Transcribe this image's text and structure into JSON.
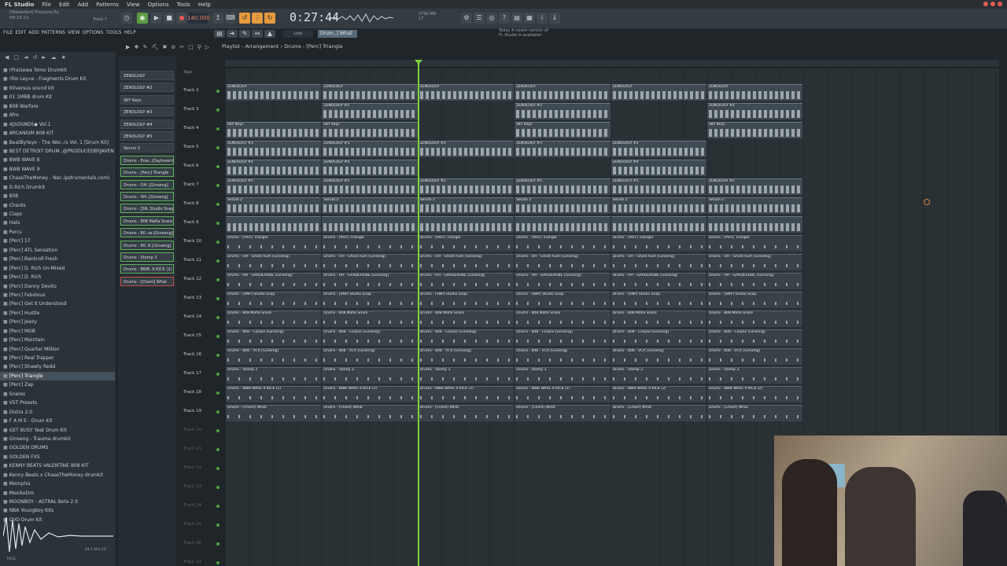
{
  "menubar": {
    "app": "FL Studio",
    "items": [
      "File",
      "Edit",
      "Add",
      "Patterns",
      "View",
      "Options",
      "Tools",
      "Help"
    ]
  },
  "toolbar": {
    "project_name": "[Waeerbot] Froyone.flp",
    "project_time": "58:15:21",
    "track_label": "Track 7",
    "tempo": "140.000",
    "time": "0:27:44",
    "cpu_line1": "5790 MB",
    "cpu_line2": "17",
    "hint_line1": "Today  A newer version of",
    "hint_line2": "FL Studio is available!",
    "snap": "Line",
    "pattern": "Drum..] What"
  },
  "menu_row2": [
    "FILE",
    "EDIT",
    "ADD",
    "PATTERNS",
    "VIEW",
    "OPTIONS",
    "TOOLS",
    "HELP"
  ],
  "playlist": {
    "breadcrumb": "Playlist - Arrangement › Drums - [Perc] Triangle",
    "tracks_label": "Tags"
  },
  "browser": {
    "items": [
      {
        "label": "!Praizewa Tomo Drumkit",
        "sel": false
      },
      {
        "label": "!Rio Leyva - Fragments Drum Kit",
        "sel": false
      },
      {
        "label": "00versus sound kit",
        "sel": false
      },
      {
        "label": "01 1MBB drum Kit",
        "sel": false
      },
      {
        "label": "808 Warfare",
        "sel": false
      },
      {
        "label": "Afro",
        "sel": false
      },
      {
        "label": "AJSOUNDS◆ Vol.1",
        "sel": false
      },
      {
        "label": "ARCANIUM 808 KIT",
        "sel": false
      },
      {
        "label": "BeatByYayo - The Wor..rs Vol. 1 [Drum Kit]",
        "sel": false
      },
      {
        "label": "BEST DETROIT DRUM..@PRODUCEDBYJAVEN",
        "sel": false
      },
      {
        "label": "BWB WAVE 8",
        "sel": false
      },
      {
        "label": "BWB WAVE 9",
        "sel": false
      },
      {
        "label": "ChaseTheMoney - Nar..ipstrumentals.com)",
        "sel": false
      },
      {
        "label": "D.Rich Drumkit",
        "sel": false
      },
      {
        "label": "808",
        "sel": false
      },
      {
        "label": "Chants",
        "sel": false
      },
      {
        "label": "Claps",
        "sel": false
      },
      {
        "label": "Hats",
        "sel": false
      },
      {
        "label": "Percs",
        "sel": false
      },
      {
        "label": "[Perc] 17",
        "sel": false
      },
      {
        "label": "[Perc] ATL Sensation",
        "sel": false
      },
      {
        "label": "[Perc] Bankroll Fresh",
        "sel": false
      },
      {
        "label": "[Perc] D. Rich Un-Mixed",
        "sel": false
      },
      {
        "label": "[Perc] D. Rich",
        "sel": false
      },
      {
        "label": "[Perc] Danny Devito",
        "sel": false
      },
      {
        "label": "[Perc] Fabolous",
        "sel": false
      },
      {
        "label": "[Perc] Get It Understood",
        "sel": false
      },
      {
        "label": "[Perc] Hustle",
        "sel": false
      },
      {
        "label": "[Perc] Jeezy",
        "sel": false
      },
      {
        "label": "[Perc] MOB",
        "sel": false
      },
      {
        "label": "[Perc] Maintain",
        "sel": false
      },
      {
        "label": "[Perc] Quarter Million",
        "sel": false
      },
      {
        "label": "[Perc] Real Trapper",
        "sel": false
      },
      {
        "label": "[Perc] Shawty Redd",
        "sel": false
      },
      {
        "label": "[Perc] Triangle",
        "sel": true
      },
      {
        "label": "[Perc] Zap",
        "sel": false
      },
      {
        "label": "Snares",
        "sel": false
      },
      {
        "label": "VST Presets",
        "sel": false
      },
      {
        "label": "Distra 2.0",
        "sel": false
      },
      {
        "label": "F A M E - Drum Kit",
        "sel": false
      },
      {
        "label": "GET BUSY Yeat Drum Kit",
        "sel": false
      },
      {
        "label": "Ginseng - Trauma drumkit",
        "sel": false
      },
      {
        "label": "GOLDEN DRUMS",
        "sel": false
      },
      {
        "label": "GOLDEN FXS",
        "sel": false
      },
      {
        "label": "KENNY BEATS VALENTINE 808 KIT",
        "sel": false
      },
      {
        "label": "Kenny Beats x ChaseTheMoney drumkit",
        "sel": false
      },
      {
        "label": "Memphis",
        "sel": false
      },
      {
        "label": "MexikoDro",
        "sel": false
      },
      {
        "label": "MOONBOY - ASTRAL Beta 2.0",
        "sel": false
      },
      {
        "label": "NBA Youngboy Kits",
        "sel": false
      },
      {
        "label": "OVO Drum Kit",
        "sel": false
      }
    ],
    "wave_label": "44.1 kHz 16",
    "tags": "TAGS"
  },
  "picker": [
    {
      "label": "ZENOLOGY",
      "c": ""
    },
    {
      "label": "ZENOLOGY #2",
      "c": ""
    },
    {
      "label": "SKY Keys",
      "c": ""
    },
    {
      "label": "ZENOLOGY #3",
      "c": ""
    },
    {
      "label": "ZENOLOGY #4",
      "c": ""
    },
    {
      "label": "ZENOLOGY #5",
      "c": ""
    },
    {
      "label": "Serum 2",
      "c": ""
    },
    {
      "label": "Drums - Eras..(Zaytoven)",
      "c": "g"
    },
    {
      "label": "Drums - [Perc] Triangle",
      "c": "g"
    },
    {
      "label": "Drums - OH..[Ginseng]",
      "c": "g"
    },
    {
      "label": "Drums - HH..[Ginseng]",
      "c": "g"
    },
    {
      "label": "Drums - [SN..Studio Snap",
      "c": "g"
    },
    {
      "label": "Drums - 808 Mafia Snare",
      "c": "g"
    },
    {
      "label": "Drums - 80..se [Ginseng]",
      "c": "g"
    },
    {
      "label": "Drums - 80..R [Ginseng]",
      "c": "g"
    },
    {
      "label": "Drums - Stomp 3",
      "c": "g"
    },
    {
      "label": "Drums - BWB..9 KICK (2)",
      "c": "g"
    },
    {
      "label": "Drums - [Chant] What",
      "c": "r"
    }
  ],
  "tracks": [
    {
      "name": "Track 2",
      "clip": "ZENOLOGY",
      "kind": "pat",
      "seg": [
        0,
        1,
        2,
        3,
        4,
        5
      ]
    },
    {
      "name": "Track 3",
      "clip": "ZENOLOGY #2",
      "kind": "pat",
      "seg": [
        1,
        3,
        5
      ]
    },
    {
      "name": "Track 4",
      "clip": "SKY Keys",
      "kind": "pat",
      "seg": [
        0,
        1,
        3,
        5
      ]
    },
    {
      "name": "Track 5",
      "clip": "ZENOLOGY #3",
      "kind": "pat",
      "seg": [
        0,
        1,
        2,
        3,
        4
      ]
    },
    {
      "name": "Track 6",
      "clip": "ZENOLOGY #4",
      "kind": "pat",
      "seg": [
        0,
        1,
        4
      ]
    },
    {
      "name": "Track 7",
      "clip": "ZENOLOGY #5",
      "kind": "pat",
      "seg": [
        0,
        1,
        2,
        3,
        4,
        5
      ]
    },
    {
      "name": "Track 8",
      "clip": "Serum 2",
      "kind": "pat",
      "seg": [
        0,
        1,
        2,
        3,
        4,
        5
      ]
    },
    {
      "name": "Track 9",
      "clip": "",
      "kind": "pat",
      "seg": [
        0,
        1,
        2,
        3,
        4,
        5
      ]
    },
    {
      "name": "Track 10",
      "clip": "Drums - [Perc] Triangle",
      "kind": "aud",
      "seg": [
        0,
        1,
        2,
        3,
        4,
        5
      ]
    },
    {
      "name": "Track 11",
      "clip": "Drums - OH - Ghost hum [Ginseng]",
      "kind": "aud",
      "seg": [
        0,
        1,
        2,
        3,
        4,
        5
      ]
    },
    {
      "name": "Track 12",
      "clip": "Drums - HH - GARDEROBE [Ginseng]",
      "kind": "aud",
      "seg": [
        0,
        1,
        2,
        3,
        4,
        5
      ]
    },
    {
      "name": "Track 13",
      "clip": "Drums - [SNP] Studio Snap",
      "kind": "aud",
      "seg": [
        0,
        1,
        2,
        3,
        4,
        5
      ]
    },
    {
      "name": "Track 14",
      "clip": "Drums - 808 Mafia Snare",
      "kind": "aud",
      "seg": [
        0,
        1,
        2,
        3,
        4,
        5
      ]
    },
    {
      "name": "Track 15",
      "clip": "Drums - 808 - Corpse [Ginseng]",
      "kind": "aud",
      "seg": [
        0,
        1,
        2,
        3,
        4,
        5
      ]
    },
    {
      "name": "Track 16",
      "clip": "Drums - 808 - VCR [Ginseng]",
      "kind": "aud",
      "seg": [
        0,
        1,
        2,
        3,
        4,
        5
      ]
    },
    {
      "name": "Track 17",
      "clip": "Drums - Stomp 3",
      "kind": "aud",
      "seg": [
        0,
        1,
        2,
        3,
        4,
        5
      ]
    },
    {
      "name": "Track 18",
      "clip": "Drums - BWB WAVE 9 KICK (2)",
      "kind": "aud",
      "seg": [
        0,
        1,
        2,
        3,
        4,
        5
      ]
    },
    {
      "name": "Track 19",
      "clip": "Drums - [Chant] What",
      "kind": "aud",
      "seg": [
        0,
        1,
        2,
        3,
        4,
        5
      ]
    },
    {
      "name": "Track 20",
      "clip": "",
      "kind": "",
      "seg": []
    },
    {
      "name": "Track 21",
      "clip": "",
      "kind": "",
      "seg": []
    },
    {
      "name": "Track 22",
      "clip": "",
      "kind": "",
      "seg": []
    },
    {
      "name": "Track 23",
      "clip": "",
      "kind": "",
      "seg": []
    },
    {
      "name": "Track 24",
      "clip": "",
      "kind": "",
      "seg": []
    },
    {
      "name": "Track 25",
      "clip": "",
      "kind": "",
      "seg": []
    },
    {
      "name": "Track 26",
      "clip": "",
      "kind": "",
      "seg": []
    },
    {
      "name": "Track 27",
      "clip": "",
      "kind": "",
      "seg": []
    }
  ]
}
